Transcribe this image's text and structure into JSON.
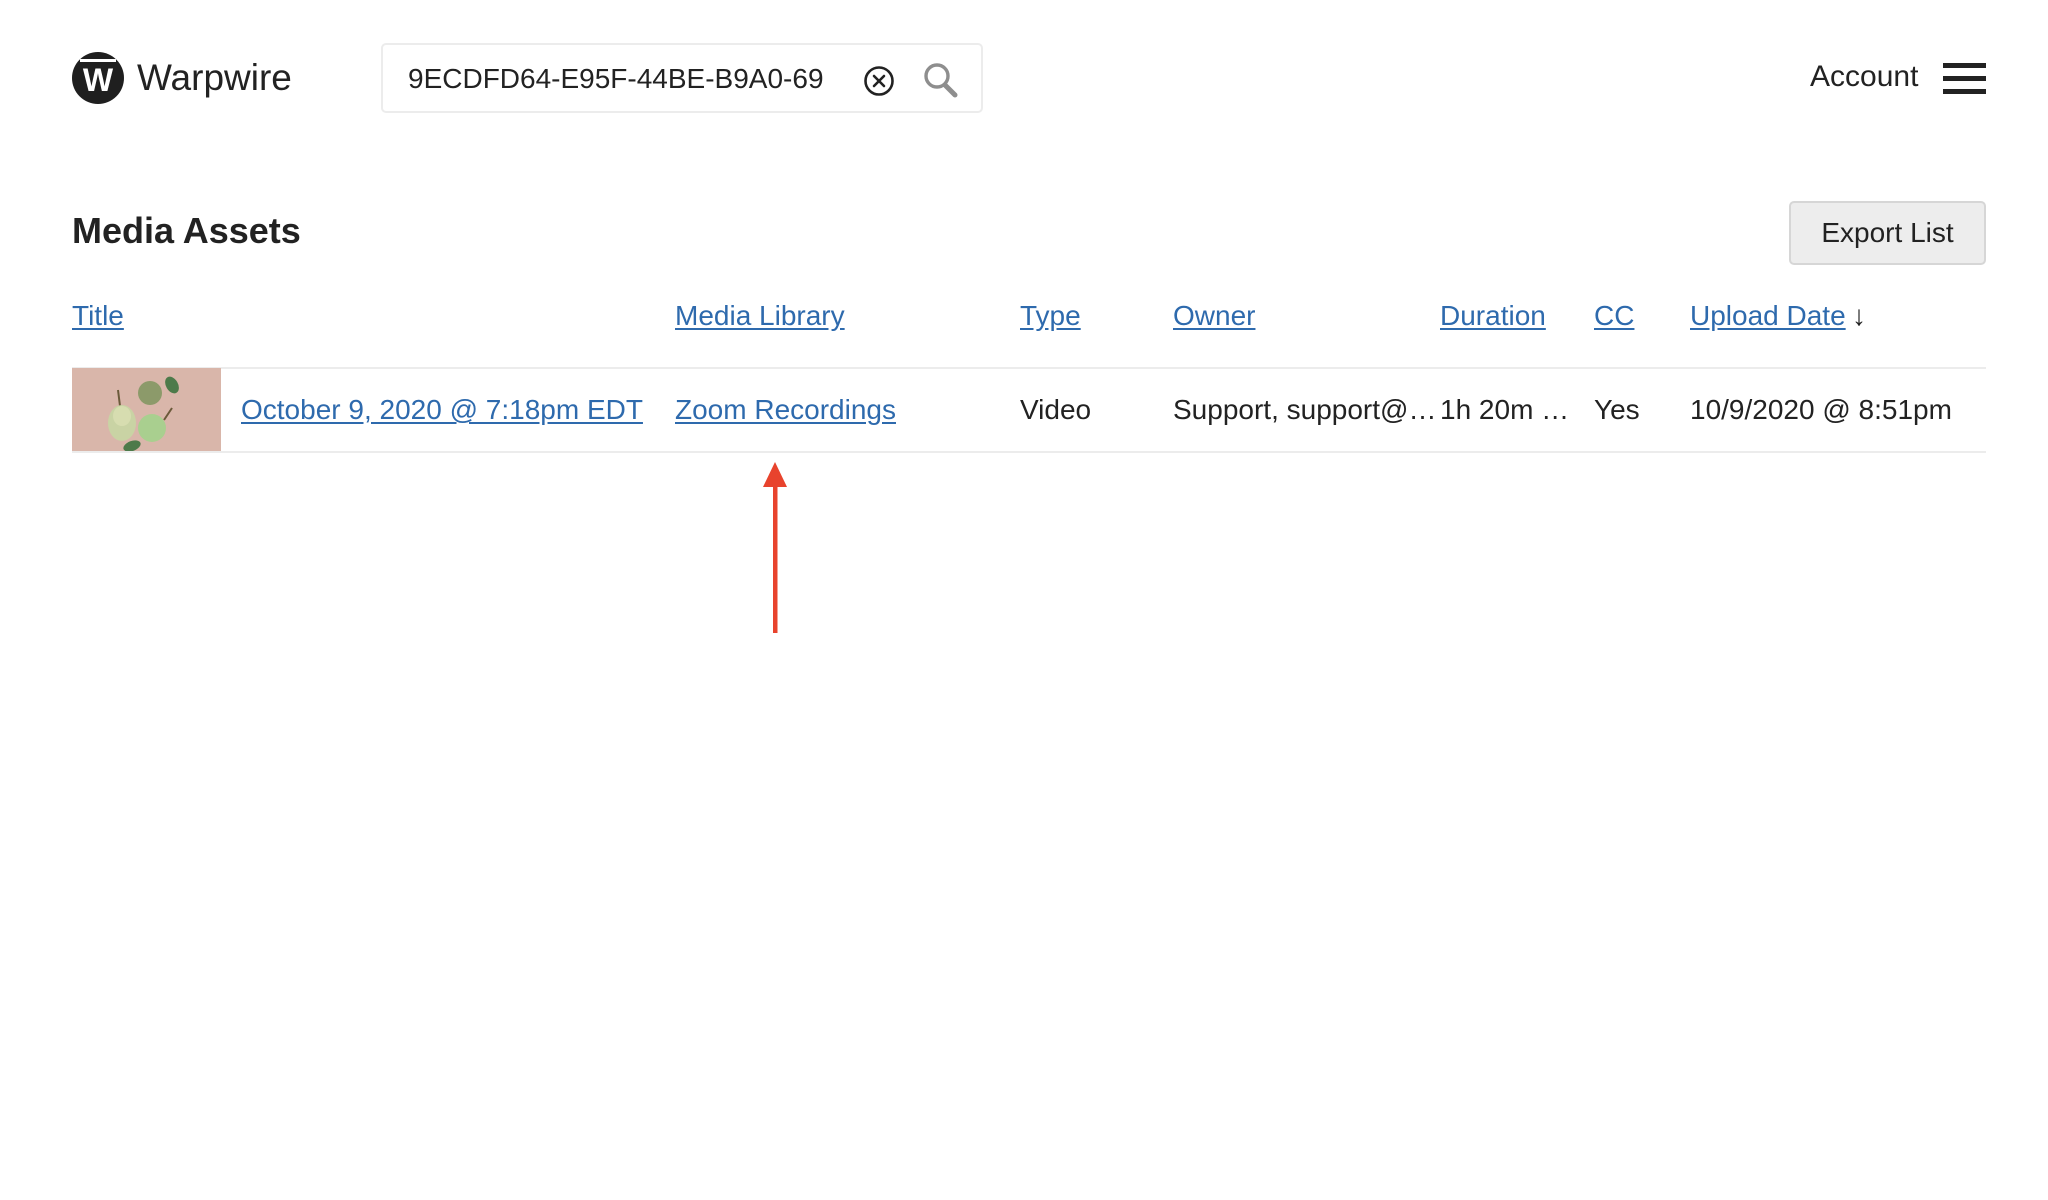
{
  "brand": {
    "name": "Warpwire",
    "logo_letter": "W"
  },
  "search": {
    "value": "9ECDFD64-E95F-44BE-B9A0-69",
    "clear_icon": "clear-circle-x-icon",
    "search_icon": "magnifier-icon"
  },
  "header": {
    "account_label": "Account",
    "menu_icon": "hamburger-menu-icon"
  },
  "page": {
    "title": "Media Assets",
    "export_label": "Export List"
  },
  "table": {
    "columns": [
      {
        "label": "Title"
      },
      {
        "label": "Media Library"
      },
      {
        "label": "Type"
      },
      {
        "label": "Owner"
      },
      {
        "label": "Duration"
      },
      {
        "label": "CC"
      },
      {
        "label": "Upload Date"
      }
    ],
    "sort_indicator": "↓",
    "rows": [
      {
        "thumbnail": "pears-on-pink-background",
        "title": "October 9, 2020 @ 7:18pm EDT",
        "media_library": "Zoom Recordings",
        "type": "Video",
        "owner": "Support, support@…",
        "duration": "1h 20m …",
        "cc": "Yes",
        "upload_date": "10/9/2020 @ 8:51pm"
      }
    ]
  },
  "annotation": {
    "type": "arrow-up",
    "color": "#e8432d",
    "points_to": "Zoom Recordings"
  },
  "colors": {
    "link": "#2e6aad",
    "text": "#222222",
    "border": "#ececec",
    "button_bg": "#ededed"
  }
}
